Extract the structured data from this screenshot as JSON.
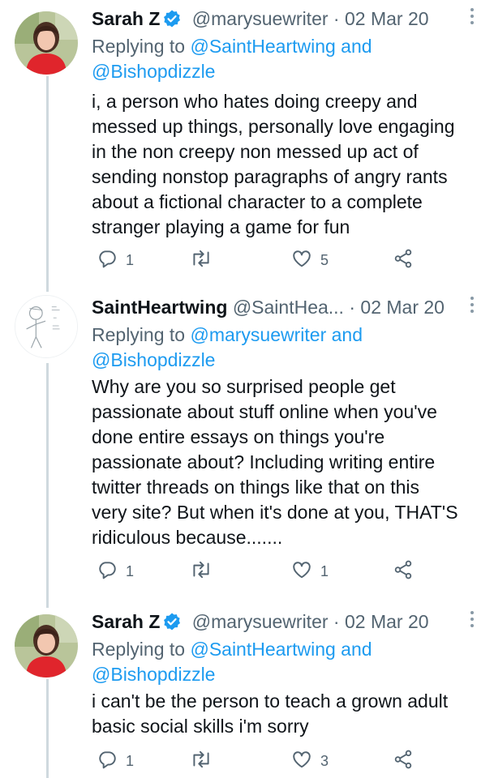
{
  "tweets": [
    {
      "name": "Sarah Z",
      "verified": true,
      "handle": "@marysuewriter",
      "separator": "·",
      "date": "02 Mar 20",
      "replying_prefix": "Replying to",
      "replying_targets": "@SaintHeartwing and",
      "replying_targets_2": "@Bishopdizzle",
      "lines": [
        "i, a person who hates doing creepy and",
        "messed up things, personally love engaging",
        "in the non creepy non messed up act of",
        "sending nonstop paragraphs of angry rants",
        "about a fictional character to a complete",
        "stranger playing a game for fun"
      ],
      "replies": "1",
      "retweets": "",
      "likes": "5"
    },
    {
      "name": "SaintHeartwing",
      "verified": false,
      "handle": "@SaintHea...",
      "separator": "·",
      "date": "02 Mar 20",
      "replying_prefix": "Replying to",
      "replying_targets": "@marysuewriter and",
      "replying_targets_2": "@Bishopdizzle",
      "lines": [
        "Why are you so surprised people get",
        "passionate about stuff online when you've",
        "done entire essays on things you're",
        "passionate about? Including writing entire",
        "twitter threads on things like that on this",
        "very site? But when it's done at you, THAT'S",
        "ridiculous because......."
      ],
      "replies": "1",
      "retweets": "",
      "likes": "1"
    },
    {
      "name": "Sarah Z",
      "verified": true,
      "handle": "@marysuewriter",
      "separator": "·",
      "date": "02 Mar 20",
      "replying_prefix": "Replying to",
      "replying_targets": "@SaintHeartwing and",
      "replying_targets_2": "@Bishopdizzle",
      "lines": [
        "i can't be the person to teach a grown adult",
        "basic social skills i'm sorry"
      ],
      "replies": "1",
      "retweets": "",
      "likes": "3"
    }
  ],
  "icons": {
    "reply": "reply-icon",
    "retweet": "retweet-icon",
    "like": "heart-icon",
    "share": "share-icon",
    "verified": "verified-badge-icon",
    "more": "more-options-icon"
  },
  "colors": {
    "link": "#1d9bf0",
    "secondary_text": "#536471",
    "verified": "#1d9bf0",
    "thread_line": "#cfd9de"
  }
}
